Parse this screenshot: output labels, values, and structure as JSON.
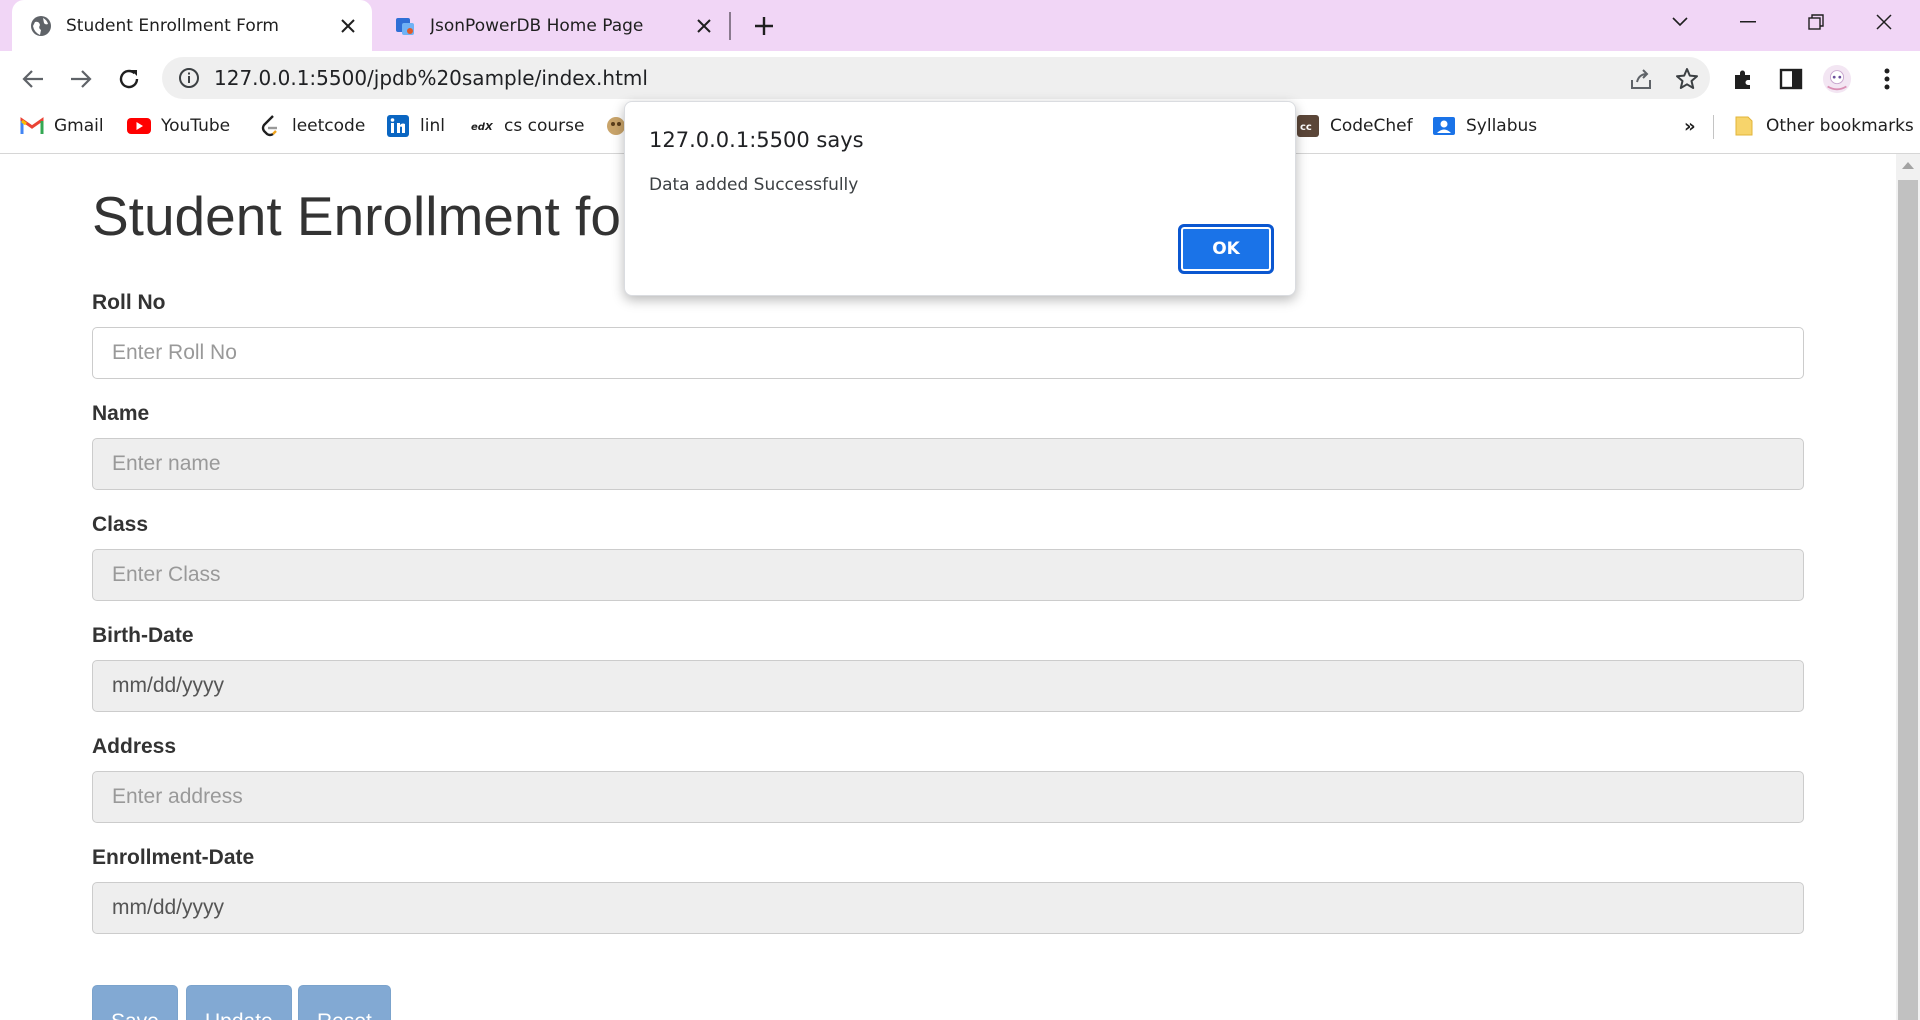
{
  "browser": {
    "tabs": [
      {
        "title": "Student Enrollment Form",
        "icon": "globe-icon",
        "active": true
      },
      {
        "title": "JsonPowerDB Home Page",
        "icon": "jsonpowerdb-icon",
        "active": false
      }
    ],
    "url": "127.0.0.1:5500/jpdb%20sample/index.html",
    "bookmarks": [
      {
        "label": "Gmail",
        "icon": "gmail-icon"
      },
      {
        "label": "YouTube",
        "icon": "youtube-icon"
      },
      {
        "label": "leetcode",
        "icon": "leetcode-icon"
      },
      {
        "label": "linl",
        "icon": "linkedin-icon"
      },
      {
        "label": "cs course",
        "icon": "edx-icon"
      },
      {
        "label": "",
        "icon": "bookmark-favicon-icon"
      },
      {
        "label": "CodeChef",
        "icon": "codechef-icon"
      },
      {
        "label": "Syllabus",
        "icon": "syllabus-icon"
      }
    ],
    "bookmarks_overflow": "»",
    "other_bookmarks": "Other bookmarks"
  },
  "page": {
    "title": "Student Enrollment form",
    "fields": [
      {
        "label": "Roll No",
        "placeholder": "Enter Roll No"
      },
      {
        "label": "Name",
        "placeholder": "Enter name"
      },
      {
        "label": "Class",
        "placeholder": "Enter Class"
      },
      {
        "label": "Birth-Date",
        "value": "mm/dd/yyyy"
      },
      {
        "label": "Address",
        "placeholder": "Enter address"
      },
      {
        "label": "Enrollment-Date",
        "value": "mm/dd/yyyy"
      }
    ],
    "buttons": {
      "save": "Save",
      "update": "Update",
      "reset": "Reset"
    }
  },
  "dialog": {
    "title": "127.0.0.1:5500 says",
    "message": "Data added Successfully",
    "ok": "OK"
  },
  "colors": {
    "tabstrip": "#f1d6f6",
    "primary_button": "#1a73e8",
    "form_button": "#82a9d3"
  }
}
